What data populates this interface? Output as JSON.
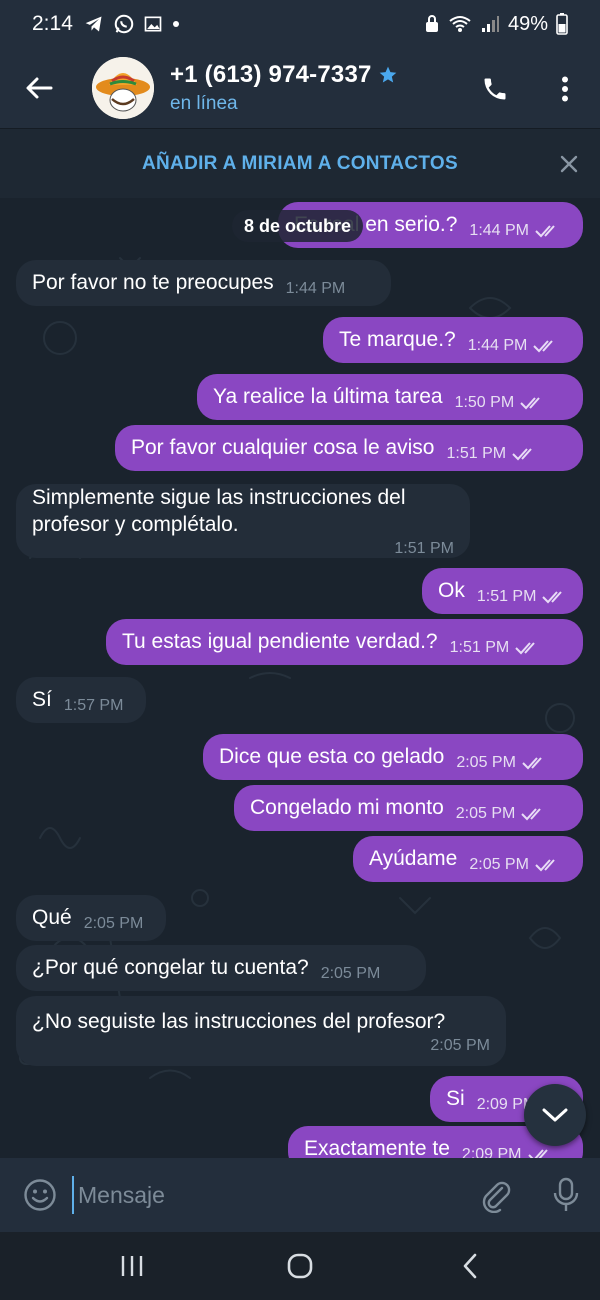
{
  "status_bar": {
    "time": "2:14",
    "battery": "49%"
  },
  "header": {
    "contact_name": "+1 (613) 974-7337",
    "contact_status": "en línea"
  },
  "add_contact": {
    "label": "AÑADIR A MIRIAM A CONTACTOS"
  },
  "chat": {
    "date_pill": "8 de octubre",
    "messages": [
      {
        "dir": "out",
        "text": "Es real en serio.?",
        "time": "1:44 PM"
      },
      {
        "dir": "in",
        "text": "Por favor no te preocupes",
        "time": "1:44 PM"
      },
      {
        "dir": "out",
        "text": "Te marque.?",
        "time": "1:44 PM"
      },
      {
        "dir": "out",
        "text": "Ya realice la última tarea",
        "time": "1:50 PM"
      },
      {
        "dir": "out",
        "text": "Por favor cualquier cosa le aviso",
        "time": "1:51 PM"
      },
      {
        "dir": "in",
        "text": "Simplemente sigue las instrucciones del profesor y complétalo.",
        "time": "1:51 PM"
      },
      {
        "dir": "out",
        "text": "Ok",
        "time": "1:51 PM"
      },
      {
        "dir": "out",
        "text": "Tu estas igual pendiente verdad.?",
        "time": "1:51 PM"
      },
      {
        "dir": "in",
        "text": "Sí",
        "time": "1:57 PM"
      },
      {
        "dir": "out",
        "text": "Dice que esta co gelado",
        "time": "2:05 PM"
      },
      {
        "dir": "out",
        "text": "Congelado mi monto",
        "time": "2:05 PM"
      },
      {
        "dir": "out",
        "text": "Ayúdame",
        "time": "2:05 PM"
      },
      {
        "dir": "in",
        "text": "Qué",
        "time": "2:05 PM"
      },
      {
        "dir": "in",
        "text": "¿Por qué congelar tu cuenta?",
        "time": "2:05 PM"
      },
      {
        "dir": "in",
        "text": "¿No seguiste las instrucciones del profesor?",
        "time": "2:05 PM"
      },
      {
        "dir": "out",
        "text": "Si",
        "time": "2:09 PM"
      },
      {
        "dir": "out",
        "text": "Exactamente te",
        "time": "2:09 PM"
      }
    ]
  },
  "composer": {
    "placeholder": "Mensaje"
  },
  "icons": {
    "back": "arrow-left-icon",
    "call": "phone-icon",
    "more": "more-vertical-icon",
    "close": "close-icon",
    "emoji": "emoji-icon",
    "attach": "paperclip-icon",
    "mic": "microphone-icon",
    "scroll": "chevron-down-icon"
  },
  "colors": {
    "outgoing_bubble": "#8a47c2",
    "incoming_bubble": "#232d39",
    "accent": "#5fb0ea",
    "header_bg": "#232e3c"
  }
}
